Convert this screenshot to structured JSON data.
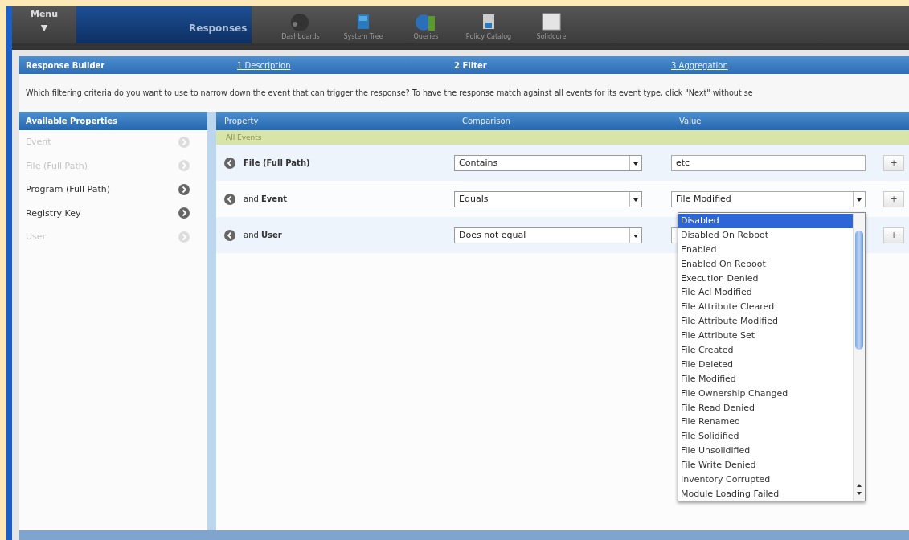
{
  "menu": {
    "label": "Menu",
    "caret": "▼"
  },
  "module": {
    "label": "Responses"
  },
  "nav": [
    {
      "label": "Dashboards",
      "kind": "gauge"
    },
    {
      "label": "System Tree",
      "kind": "tree"
    },
    {
      "label": "Queries",
      "kind": "chart"
    },
    {
      "label": "Policy Catalog",
      "kind": "catalog"
    },
    {
      "label": "Solidcore",
      "kind": "doc"
    }
  ],
  "wizard": {
    "title": "Response Builder",
    "steps": [
      {
        "label": "1 Description",
        "selected": false
      },
      {
        "label": "2 Filter",
        "selected": true
      },
      {
        "label": "3 Aggregation",
        "selected": false
      }
    ]
  },
  "instructions": "Which filtering criteria do you want to use to narrow down the event that can trigger the response? To have the response match against all events for its event type, click \"Next\" without se",
  "available": {
    "title": "Available Properties",
    "items": [
      {
        "label": "Event",
        "disabled": true
      },
      {
        "label": "File (Full Path)",
        "disabled": true
      },
      {
        "label": "Program (Full Path)",
        "disabled": false
      },
      {
        "label": "Registry Key",
        "disabled": false
      },
      {
        "label": "User",
        "disabled": true
      }
    ]
  },
  "filter": {
    "columns": [
      "Property",
      "Comparison",
      "Value"
    ],
    "group": "All Events",
    "rows": [
      {
        "property": "**File (Full Path)**",
        "comparison": "Contains",
        "value": {
          "kind": "text",
          "value": "etc"
        },
        "add": "+"
      },
      {
        "property": "and **Event**",
        "comparison": "Equals",
        "value": {
          "kind": "select",
          "value": "File Modified"
        },
        "add": "+"
      },
      {
        "property": "and **User**",
        "comparison": "Does not equal",
        "value": {
          "kind": "text"
        },
        "add": "+"
      }
    ]
  },
  "dropdown": {
    "options": [
      {
        "label": "Disabled",
        "selected": true
      },
      {
        "label": "Disabled On Reboot",
        "selected": false
      },
      {
        "label": "Enabled",
        "selected": false
      },
      {
        "label": "Enabled On Reboot",
        "selected": false
      },
      {
        "label": "Execution Denied",
        "selected": false
      },
      {
        "label": "File Acl Modified",
        "selected": false
      },
      {
        "label": "File Attribute Cleared",
        "selected": false
      },
      {
        "label": "File Attribute Modified",
        "selected": false
      },
      {
        "label": "File Attribute Set",
        "selected": false
      },
      {
        "label": "File Created",
        "selected": false
      },
      {
        "label": "File Deleted",
        "selected": false
      },
      {
        "label": "File Modified",
        "selected": false
      },
      {
        "label": "File Ownership Changed",
        "selected": false
      },
      {
        "label": "File Read Denied",
        "selected": false
      },
      {
        "label": "File Renamed",
        "selected": false
      },
      {
        "label": "File Solidified",
        "selected": false
      },
      {
        "label": "File Unsolidified",
        "selected": false
      },
      {
        "label": "File Write Denied",
        "selected": false
      },
      {
        "label": "Inventory Corrupted",
        "selected": false
      },
      {
        "label": "Module Loading Failed",
        "selected": false
      }
    ]
  }
}
